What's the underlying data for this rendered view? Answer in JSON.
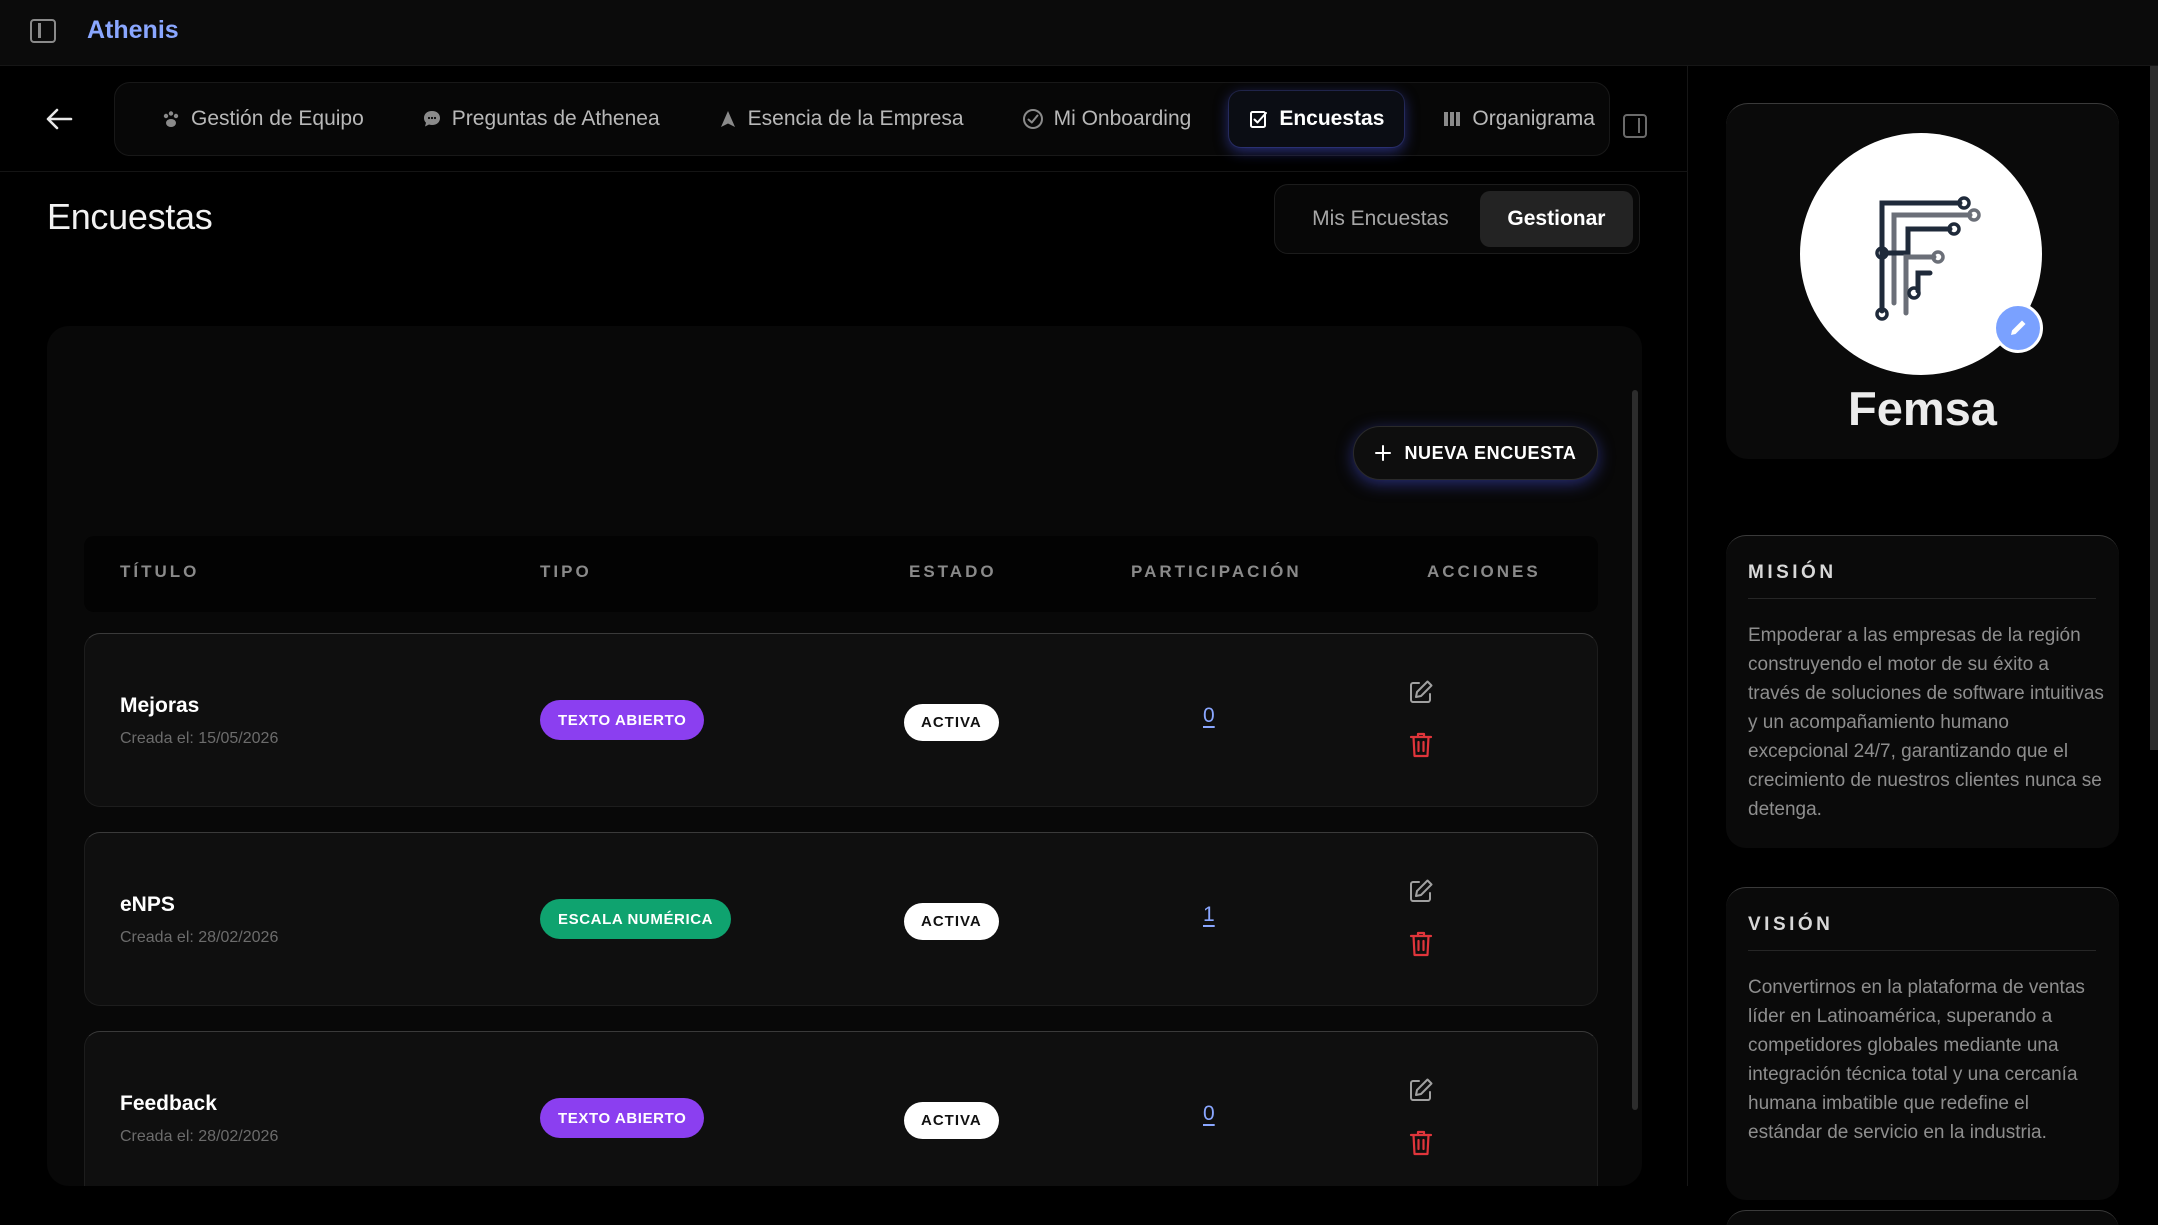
{
  "app": {
    "brand": "Athenis"
  },
  "nav": {
    "tabs": [
      {
        "label": "Gestión de Equipo",
        "icon": "paw-icon"
      },
      {
        "label": "Preguntas de Athenea",
        "icon": "chat-bubble-icon"
      },
      {
        "label": "Esencia de la Empresa",
        "icon": "navigation-arrow-icon"
      },
      {
        "label": "Mi Onboarding",
        "icon": "check-circle-icon"
      },
      {
        "label": "Encuestas",
        "icon": "checklist-icon",
        "active": true
      },
      {
        "label": "Organigrama",
        "icon": "columns-icon"
      }
    ]
  },
  "page": {
    "title": "Encuestas",
    "segment": {
      "mine": "Mis Encuestas",
      "manage": "Gestionar",
      "selected": "manage"
    },
    "new_button": "NUEVA ENCUESTA"
  },
  "table": {
    "headers": {
      "title": "TÍTULO",
      "type": "TIPO",
      "status": "ESTADO",
      "participation": "PARTICIPACIÓN",
      "actions": "ACCIONES"
    },
    "rows": [
      {
        "title": "Mejoras",
        "created": "Creada el: 15/05/2026",
        "type": "TEXTO ABIERTO",
        "type_color": "#8b3ff0",
        "status": "ACTIVA",
        "participation": "0"
      },
      {
        "title": "eNPS",
        "created": "Creada el: 28/02/2026",
        "type": "ESCALA NUMÉRICA",
        "type_color": "#0fa36f",
        "status": "ACTIVA",
        "participation": "1"
      },
      {
        "title": "Feedback",
        "created": "Creada el: 28/02/2026",
        "type": "TEXTO ABIERTO",
        "type_color": "#8b3ff0",
        "status": "ACTIVA",
        "participation": "0"
      }
    ]
  },
  "company": {
    "name": "Femsa",
    "mission": {
      "heading": "MISIÓN",
      "text": "Empoderar a las empresas de la región construyendo el motor de su éxito a través de soluciones de software intuitivas y un acompañamiento humano excepcional 24/7, garantizando que el crecimiento de nuestros clientes nunca se detenga."
    },
    "vision": {
      "heading": "VISIÓN",
      "text": "Convertirnos en la plataforma de ventas líder en Latinoamérica, superando a competidores globales mediante una integración técnica total y una cercanía humana imbatible que redefine el estándar de servicio en la industria."
    }
  },
  "colors": {
    "accent": "#8aa7ff",
    "danger": "#e0353b",
    "purple": "#8b3ff0",
    "green": "#0fa36f"
  }
}
